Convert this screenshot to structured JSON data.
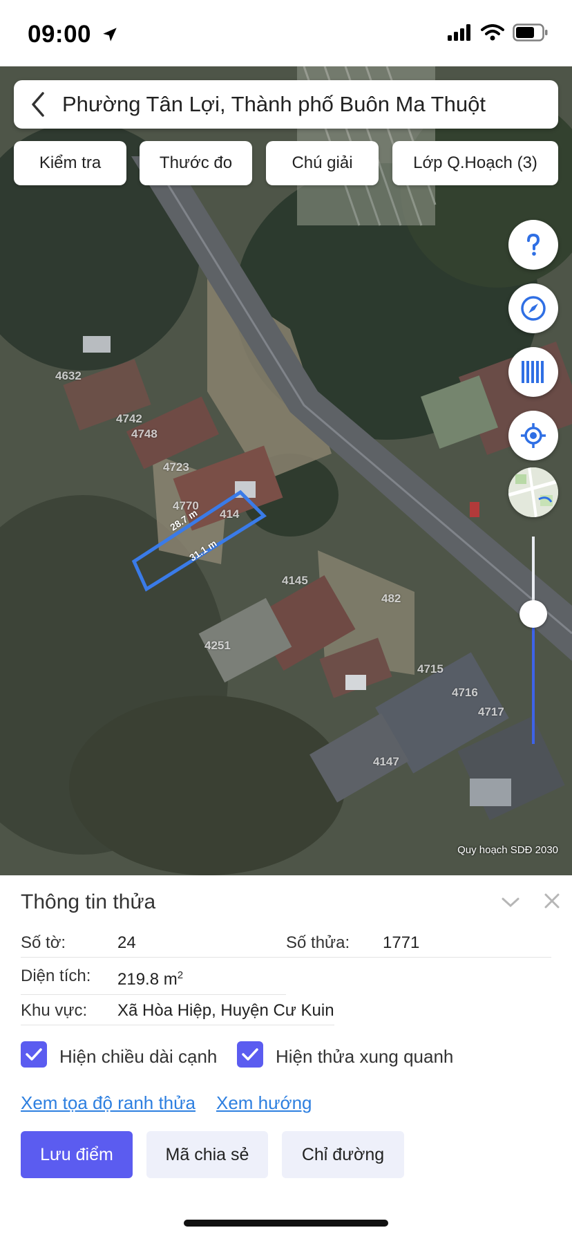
{
  "status_bar": {
    "time": "09:00"
  },
  "header": {
    "title": "Phường Tân Lợi, Thành phố Buôn Ma Thuột"
  },
  "toolbar": {
    "chips": [
      "Kiểm tra",
      "Thước đo",
      "Chú giải",
      "Lớp Q.Hoạch (3)"
    ]
  },
  "map": {
    "parcel_labels": [
      "4632",
      "4742",
      "4748",
      "4723",
      "4770",
      "414",
      "4145",
      "482",
      "4715",
      "4716",
      "4717",
      "4147",
      "4251"
    ],
    "edge_lengths": [
      "28.7 m",
      "31.1 m"
    ],
    "credit": "Quy hoạch SDĐ 2030",
    "zoom_level_fraction": 0.63,
    "side_buttons": [
      "help-icon",
      "compass-icon",
      "barcode-icon",
      "locate-icon",
      "map-thumbnail"
    ]
  },
  "parcel_info": {
    "title": "Thông tin thửa",
    "sheet_label": "Số tờ:",
    "sheet_value": "24",
    "parcel_label": "Số thửa:",
    "parcel_value": "1771",
    "area_label": "Diện tích:",
    "area_value": "219.8 m",
    "area_unit_sup": "2",
    "region_label": "Khu vực:",
    "region_value": "Xã Hòa Hiệp, Huyện Cư Kuin",
    "show_edge_length": "Hiện chiều dài cạnh",
    "show_neighbors": "Hiện thửa xung quanh",
    "link_coords": "Xem tọa độ ranh thửa",
    "link_direction": "Xem hướng",
    "btn_save": "Lưu điểm",
    "btn_share": "Mã chia sẻ",
    "btn_directions": "Chỉ đường"
  },
  "colors": {
    "accent": "#5b5cf0",
    "link": "#2d7fe0",
    "parcel_outline": "#3a7be8"
  }
}
